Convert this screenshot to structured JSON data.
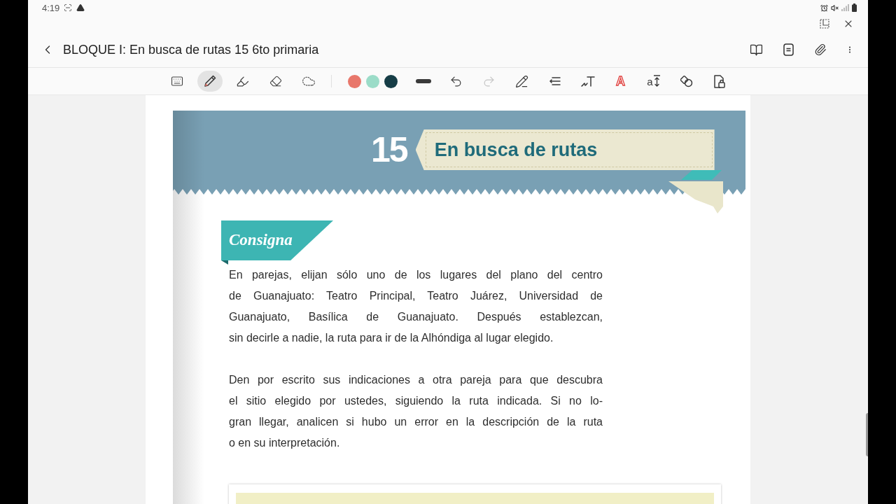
{
  "status_bar": {
    "time": "4:19"
  },
  "app_bar": {
    "title": "BLOQUE I: En busca de rutas 15 6to primaria"
  },
  "toolbar": {
    "tools": [
      {
        "kind": "keyboard",
        "selected": false
      },
      {
        "kind": "pen",
        "selected": true
      },
      {
        "kind": "highlighter",
        "selected": false
      },
      {
        "kind": "eraser",
        "selected": false
      },
      {
        "kind": "lasso",
        "selected": false
      }
    ],
    "colors": [
      {
        "color": "#e8776b"
      },
      {
        "color": "#9bdcc8"
      },
      {
        "color": "#163d46"
      }
    ],
    "actions": [
      {
        "kind": "stroke-width",
        "disabled": false
      },
      {
        "kind": "undo",
        "disabled": false
      },
      {
        "kind": "redo",
        "disabled": true
      },
      {
        "kind": "pen-mode",
        "disabled": false
      },
      {
        "kind": "align",
        "disabled": false
      },
      {
        "kind": "handwriting-to-text",
        "disabled": false
      },
      {
        "kind": "text-style",
        "glyph": "A",
        "disabled": false
      },
      {
        "kind": "text-spacing",
        "glyph": "a",
        "disabled": false
      },
      {
        "kind": "shapes",
        "disabled": false
      },
      {
        "kind": "lock",
        "disabled": false
      }
    ]
  },
  "page": {
    "chapter_number": "15",
    "chapter_title": "En busca de rutas",
    "section_label": "Consigna",
    "paragraphs": [
      [
        "En parejas, elijan sólo uno de los lugares del plano del centro",
        "de Guanajuato: Teatro Principal, Teatro Juárez, Universidad de",
        "Guanajuato, Basílica de Guanajuato. Después establezcan,",
        "sin decirle a nadie, la ruta para ir de la Alhóndiga al lugar elegido."
      ],
      [
        "Den por escrito sus indicaciones a otra pareja para que descubra",
        "el sitio elegido por ustedes, siguiendo la ruta indicada. Si no lo-",
        "gran llegar, analicen si hubo un error en la descripción de la ruta",
        "o en su interpretación."
      ]
    ]
  }
}
